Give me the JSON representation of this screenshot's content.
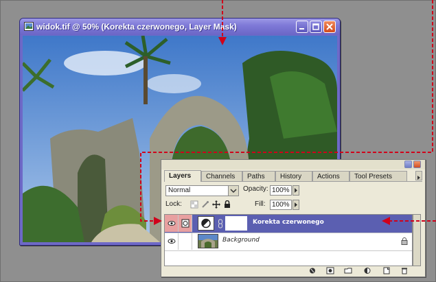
{
  "document_window": {
    "title": "widok.tif @ 50% (Korekta czerwonego, Layer Mask)",
    "buttons": [
      "minimize",
      "maximize",
      "close"
    ],
    "image_icon": "image-document-icon"
  },
  "layers_palette": {
    "tabs": [
      {
        "label": "Layers",
        "active": true
      },
      {
        "label": "Channels",
        "active": false
      },
      {
        "label": "Paths",
        "active": false
      },
      {
        "label": "History",
        "active": false
      },
      {
        "label": "Actions",
        "active": false
      },
      {
        "label": "Tool Presets",
        "active": false
      }
    ],
    "blend_mode": "Normal",
    "opacity_label": "Opacity:",
    "opacity_value": "100%",
    "lock_label": "Lock:",
    "fill_label": "Fill:",
    "fill_value": "100%",
    "layers": [
      {
        "name": "Korekta czerwonego",
        "selected": true,
        "visible": true
      },
      {
        "name": "Background",
        "selected": false,
        "visible": true,
        "locked": true
      }
    ]
  },
  "colors": {
    "window_title": "#7f7ad8",
    "selected_layer": "#5b5fb1",
    "annotation": "#d0001a",
    "palette_bg": "#ece9d8"
  }
}
